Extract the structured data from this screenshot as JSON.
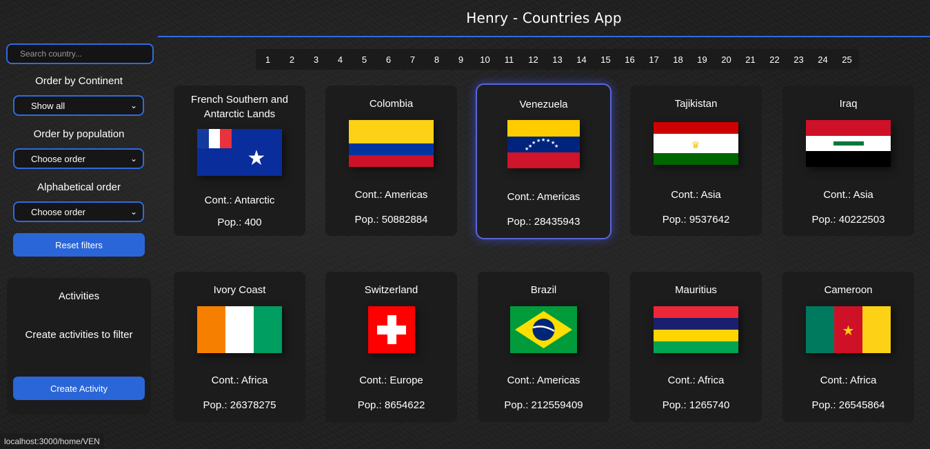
{
  "app_title": "Henry - Countries App",
  "search": {
    "placeholder": "Search country..."
  },
  "filters": {
    "continent_label": "Order by Continent",
    "continent_value": "Show all",
    "population_label": "Order by population",
    "population_value": "Choose order",
    "alpha_label": "Alphabetical order",
    "alpha_value": "Choose order",
    "reset_label": "Reset filters"
  },
  "activities": {
    "title": "Activities",
    "message": "Create activities to filter",
    "create_label": "Create Activity"
  },
  "pages": [
    "1",
    "2",
    "3",
    "4",
    "5",
    "6",
    "7",
    "8",
    "9",
    "10",
    "11",
    "12",
    "13",
    "14",
    "15",
    "16",
    "17",
    "18",
    "19",
    "20",
    "21",
    "22",
    "23",
    "24",
    "25"
  ],
  "cards": [
    {
      "name": "French Southern and Antarctic Lands",
      "cont": "Cont.: Antarctic",
      "pop": "Pop.: 400",
      "flag": "french-southern-flag"
    },
    {
      "name": "Colombia",
      "cont": "Cont.: Americas",
      "pop": "Pop.: 50882884",
      "flag": "colombia-flag"
    },
    {
      "name": "Venezuela",
      "cont": "Cont.: Americas",
      "pop": "Pop.: 28435943",
      "flag": "venezuela-flag",
      "selected": true
    },
    {
      "name": "Tajikistan",
      "cont": "Cont.: Asia",
      "pop": "Pop.: 9537642",
      "flag": "tajikistan-flag"
    },
    {
      "name": "Iraq",
      "cont": "Cont.: Asia",
      "pop": "Pop.: 40222503",
      "flag": "iraq-flag"
    },
    {
      "name": "Ivory Coast",
      "cont": "Cont.: Africa",
      "pop": "Pop.: 26378275",
      "flag": "ivory-coast-flag"
    },
    {
      "name": "Switzerland",
      "cont": "Cont.: Europe",
      "pop": "Pop.: 8654622",
      "flag": "switzerland-flag"
    },
    {
      "name": "Brazil",
      "cont": "Cont.: Americas",
      "pop": "Pop.: 212559409",
      "flag": "brazil-flag"
    },
    {
      "name": "Mauritius",
      "cont": "Cont.: Africa",
      "pop": "Pop.: 1265740",
      "flag": "mauritius-flag"
    },
    {
      "name": "Cameroon",
      "cont": "Cont.: Africa",
      "pop": "Pop.: 26545864",
      "flag": "cameroon-flag"
    }
  ],
  "status_url": "localhost:3000/home/VEN",
  "colors": {
    "accent": "#2f6be0",
    "button": "#2a66d8",
    "card": "#1c1c1c",
    "selected_glow": "#5a66d6"
  }
}
